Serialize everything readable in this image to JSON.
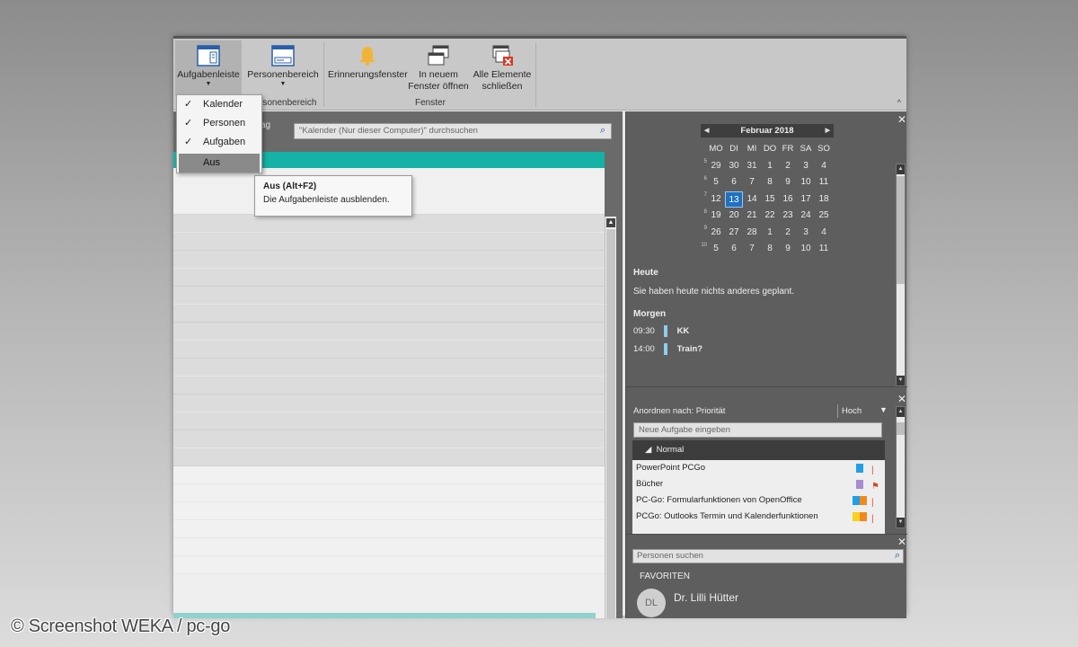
{
  "ribbon": {
    "buttons": [
      {
        "label": "Aufgabenleiste",
        "icon": "layout-pane-icon"
      },
      {
        "label": "Personenbereich",
        "icon": "layout-pane-icon"
      },
      {
        "label": "Erinnerungsfenster",
        "icon": "bell-icon"
      },
      {
        "label_line1": "In neuem",
        "label_line2": "Fenster öffnen",
        "icon": "new-window-icon"
      },
      {
        "label_line1": "Alle Elemente",
        "label_line2": "schließen",
        "icon": "close-windows-icon"
      }
    ],
    "groups": [
      "rsonenbereich",
      "Fenster"
    ],
    "collapse_glyph": "^"
  },
  "dropdown": {
    "items": [
      {
        "label": "Kalender",
        "checked": true
      },
      {
        "label": "Personen",
        "checked": true
      },
      {
        "label": "Aufgaben",
        "checked": true
      },
      {
        "label": "Aus",
        "checked": false
      }
    ],
    "check_glyph": "✓"
  },
  "tooltip": {
    "title": "Aus (Alt+F2)",
    "text": "Die Aufgabenleiste ausblenden."
  },
  "main": {
    "fragment_line1": "ag",
    "fragment_line2": "",
    "search_placeholder": "\"Kalender (Nur dieser Computer)\" durchsuchen"
  },
  "minicalendar": {
    "month": "Februar 2018",
    "weekdays": [
      "MO",
      "DI",
      "MI",
      "DO",
      "FR",
      "SA",
      "SO"
    ],
    "weeknums": [
      "5",
      "6",
      "7",
      "8",
      "9",
      "10"
    ],
    "days": [
      [
        "29",
        "30",
        "31",
        "1",
        "2",
        "3",
        "4"
      ],
      [
        "5",
        "6",
        "7",
        "8",
        "9",
        "10",
        "11"
      ],
      [
        "12",
        "13",
        "14",
        "15",
        "16",
        "17",
        "18"
      ],
      [
        "19",
        "20",
        "21",
        "22",
        "23",
        "24",
        "25"
      ],
      [
        "26",
        "27",
        "28",
        "1",
        "2",
        "3",
        "4"
      ],
      [
        "5",
        "6",
        "7",
        "8",
        "9",
        "10",
        "11"
      ]
    ],
    "today": "13",
    "accent_color": "#1f70c1"
  },
  "agenda": {
    "today_heading": "Heute",
    "today_text": "Sie haben heute nichts anderes geplant.",
    "tomorrow_heading": "Morgen",
    "appointments": [
      {
        "time": "09:30",
        "title": "KK"
      },
      {
        "time": "14:00",
        "title": "Train?"
      }
    ]
  },
  "tasks": {
    "sort_label": "Anordnen nach: Priorität",
    "sort_value": "Hoch",
    "new_task_placeholder": "Neue Aufgabe eingeben",
    "group_label": "Normal",
    "items": [
      {
        "title": "PowerPoint PCGo",
        "colors": [
          "#1ea0e6"
        ]
      },
      {
        "title": "Bücher",
        "colors": [
          "#a98bd3"
        ]
      },
      {
        "title": "PC-Go: Formularfunktionen von OpenOffice",
        "colors": [
          "#1ea0e6",
          "#f08a1e"
        ]
      },
      {
        "title": "PCGo: Outlooks Termin und Kalenderfunktionen",
        "colors": [
          "#f7d21e",
          "#f08a1e"
        ]
      }
    ]
  },
  "people": {
    "search_placeholder": "Personen suchen",
    "favorites_label": "FAVORITEN",
    "contacts": [
      {
        "initials": "DL",
        "name": "Dr. Lilli Hütter"
      }
    ]
  },
  "watermark": "© Screenshot WEKA / pc-go"
}
